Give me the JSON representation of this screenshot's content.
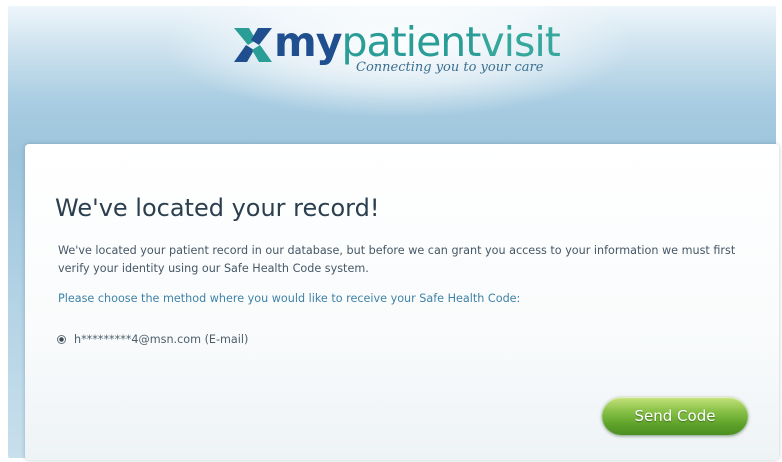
{
  "brand": {
    "name_my": "my",
    "name_patient": "patient",
    "name_visit": "visit",
    "tagline": "Connecting you to your care",
    "colors": {
      "dark_blue": "#1f4f8e",
      "teal": "#2a9d97",
      "button_green": "#5fa42b"
    }
  },
  "card": {
    "title": "We've located your record!",
    "body": "We've located your patient record in our database, but before we can grant you access to your information we must first verify your identity using our Safe Health Code system.",
    "prompt": "Please choose the method where you would like to receive your Safe Health Code:",
    "options": [
      {
        "label": "h*********4@msn.com (E-mail)",
        "selected": true
      }
    ],
    "send_button": "Send Code"
  }
}
